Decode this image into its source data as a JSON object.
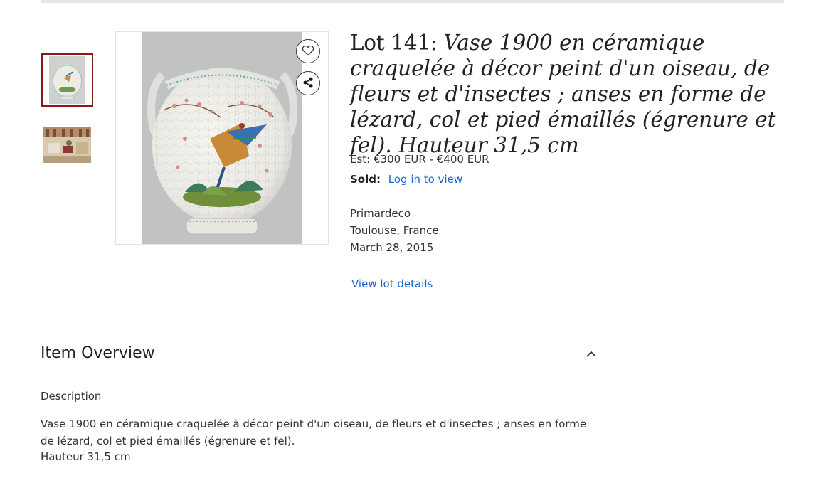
{
  "gallery": {
    "thumbnails": [
      {
        "icon": "vase-thumbnail",
        "selected": true,
        "accent": "#8b1a1a"
      },
      {
        "icon": "interior-scene-thumbnail",
        "selected": false
      }
    ],
    "main_image_icon": "crackle-glaze-moon-flask-vase"
  },
  "actions": {
    "favorite_icon": "heart-icon",
    "share_icon": "share-icon"
  },
  "lot": {
    "number_label": "Lot 141: ",
    "title": "Vase 1900 en céramique craquelée à décor peint d'un oiseau, de fleurs et d'insectes ; anses en forme de lézard, col et pied émaillés (égrenure et fel). Hauteur 31,5 cm",
    "estimate": "Est: €300 EUR - €400 EUR",
    "sold_label": "Sold:",
    "sold_link": "Log in to view",
    "auction_house": "Primardeco",
    "location": "Toulouse, France",
    "date": "March 28, 2015",
    "details_link": "View lot details"
  },
  "overview": {
    "heading": "Item Overview",
    "toggle_icon": "chevron-up-icon",
    "description_label": "Description",
    "description": "Vase 1900 en céramique craquelée à décor peint d'un oiseau, de fleurs et d'insectes ; anses en forme de lézard, col et pied émaillés (égrenure et fel).",
    "height_line": "Hauteur 31,5 cm"
  },
  "colors": {
    "link": "#1a66c9",
    "selected_border": "#8b1a1a",
    "divider": "#cfcfcf"
  }
}
